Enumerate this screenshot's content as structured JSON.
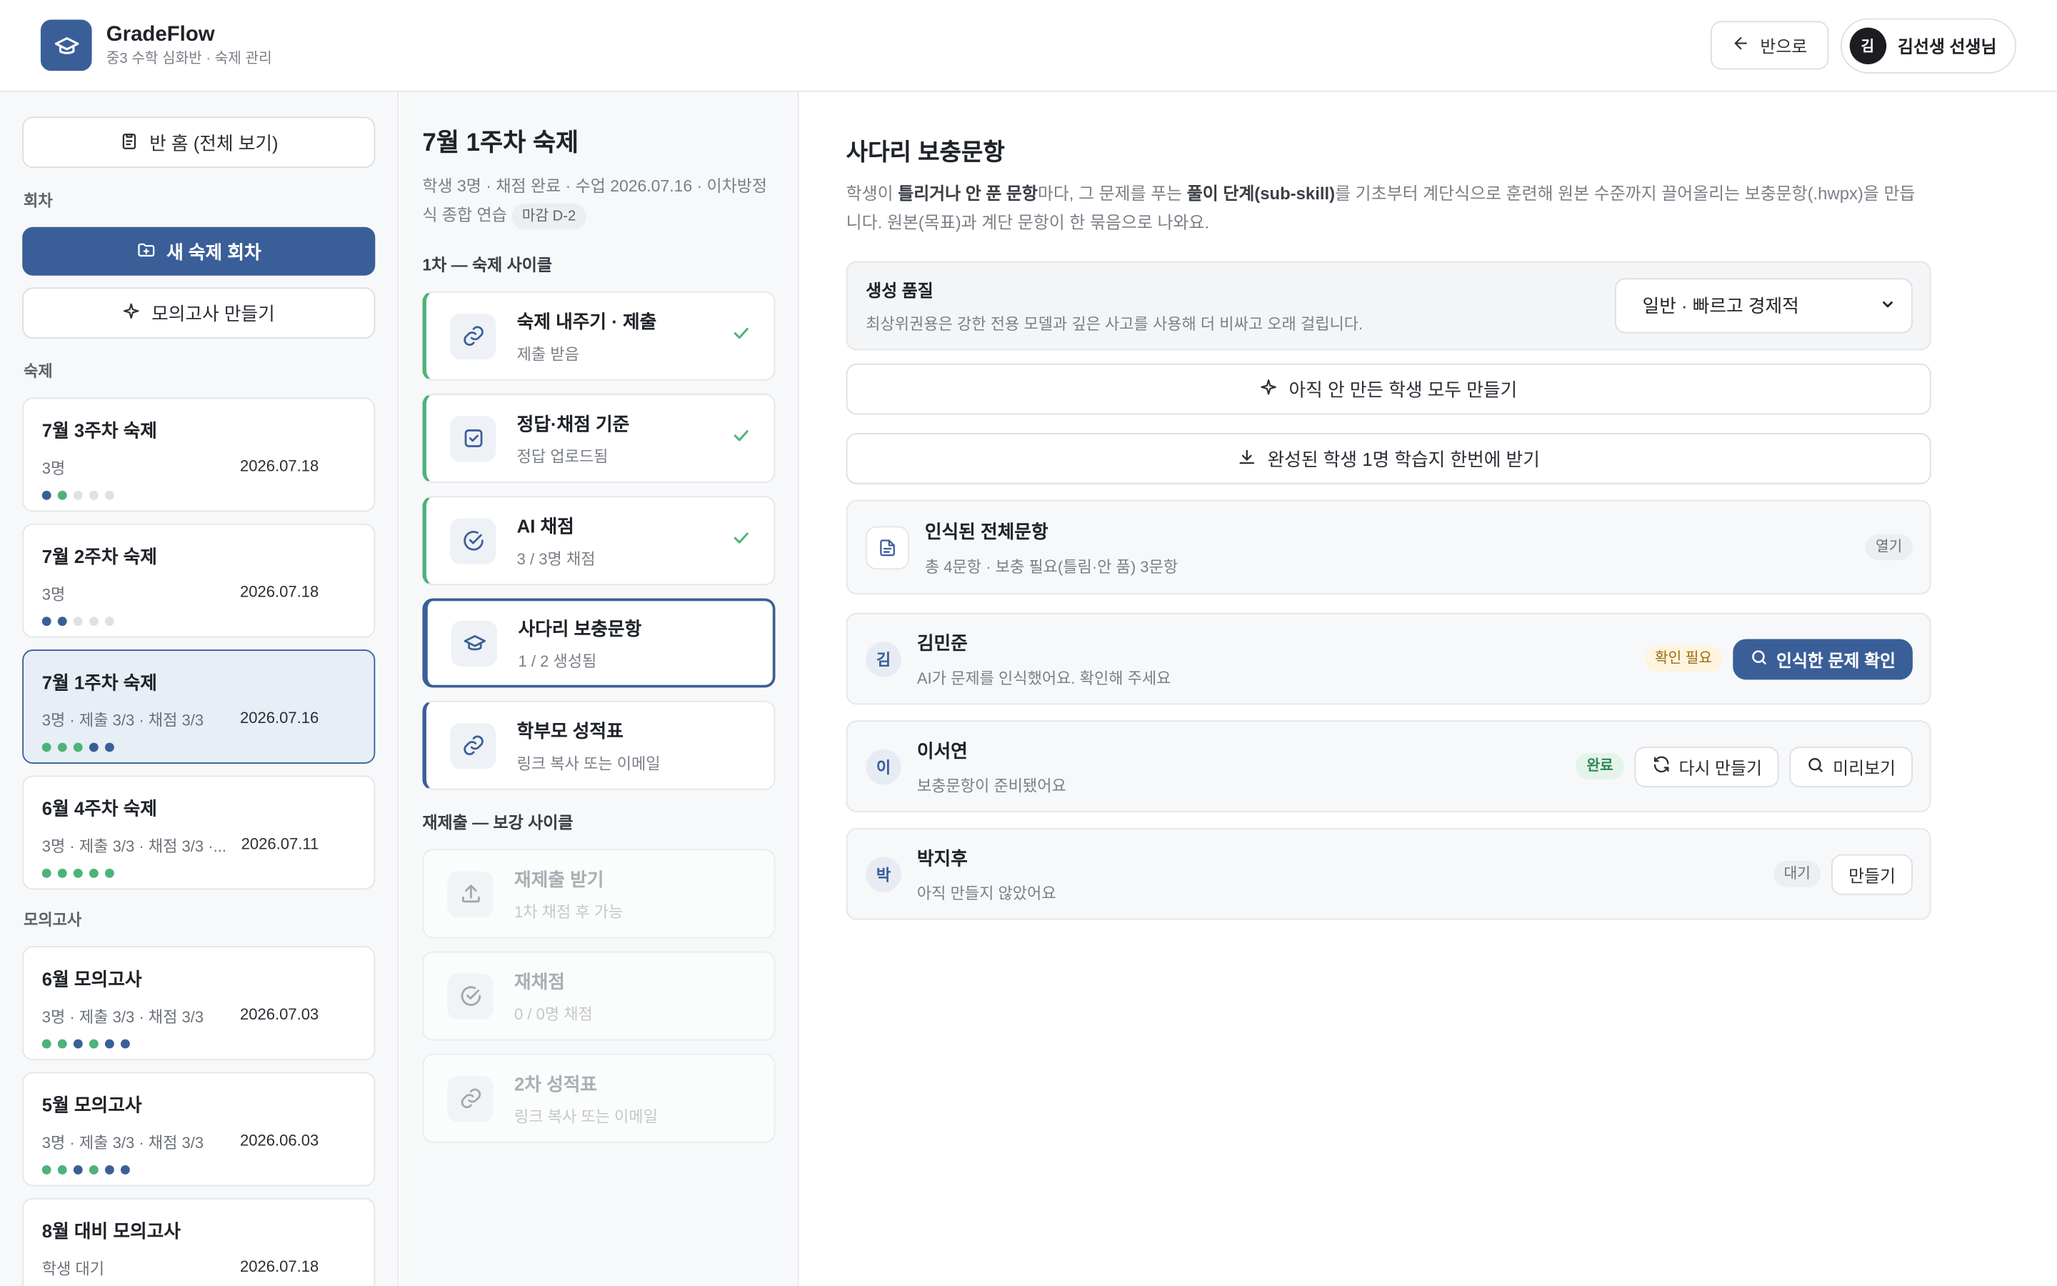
{
  "header": {
    "brand": "GradeFlow",
    "subtitle": "중3 수학 심화반 · 숙제 관리",
    "back_label": "반으로",
    "user_initial": "김",
    "user_name": "김선생 선생님"
  },
  "sidebar": {
    "home_label": "반 홈 (전체 보기)",
    "section_rounds": "회차",
    "new_round_label": "새 숙제 회차",
    "mock_exam_label": "모의고사 만들기",
    "section_homework": "숙제",
    "homework": [
      {
        "title": "7월 3주차 숙제",
        "meta": "3명",
        "date": "2026.07.18",
        "dots": [
          "blue",
          "green",
          "gray",
          "gray",
          "gray"
        ]
      },
      {
        "title": "7월 2주차 숙제",
        "meta": "3명",
        "date": "2026.07.18",
        "dots": [
          "blue",
          "blue",
          "gray",
          "gray",
          "gray"
        ]
      },
      {
        "title": "7월 1주차 숙제",
        "meta": "3명 · 제출 3/3 · 채점 3/3",
        "date": "2026.07.16",
        "dots": [
          "green",
          "green",
          "green",
          "blue",
          "blue"
        ],
        "active": true
      },
      {
        "title": "6월 4주차 숙제",
        "meta": "3명 · 제출 3/3 · 채점 3/3 ·...",
        "date": "2026.07.11",
        "dots": [
          "green",
          "green",
          "green",
          "green",
          "green"
        ]
      }
    ],
    "section_mock": "모의고사",
    "mock_exams": [
      {
        "title": "6월 모의고사",
        "meta": "3명 · 제출 3/3 · 채점 3/3",
        "date": "2026.07.03",
        "dots": [
          "green",
          "green",
          "blue",
          "green",
          "blue",
          "blue"
        ]
      },
      {
        "title": "5월 모의고사",
        "meta": "3명 · 제출 3/3 · 채점 3/3",
        "date": "2026.06.03",
        "dots": [
          "green",
          "green",
          "blue",
          "green",
          "blue",
          "blue"
        ]
      },
      {
        "title": "8월 대비 모의고사",
        "meta": "학생 대기",
        "date": "2026.07.18",
        "dots": []
      }
    ]
  },
  "pipeline": {
    "title": "7월 1주차 숙제",
    "meta": "학생 3명 · 채점 완료 · 수업 2026.07.16 · 이차방정식 종합 연습",
    "deadline": "마감 D-2",
    "section_first": "1차 — 숙제 사이클",
    "steps_first": [
      {
        "title": "숙제 내주기 · 제출",
        "sub": "제출 받음",
        "icon": "link-icon",
        "state": "done"
      },
      {
        "title": "정답·채점 기준",
        "sub": "정답 업로드됨",
        "icon": "checkbox-icon",
        "state": "done"
      },
      {
        "title": "AI 채점",
        "sub": "3 / 3명 채점",
        "icon": "check-circle-icon",
        "state": "done"
      },
      {
        "title": "사다리 보충문항",
        "sub": "1 / 2 생성됨",
        "icon": "graduation-cap-icon",
        "state": "current"
      },
      {
        "title": "학부모 성적표",
        "sub": "링크 복사 또는 이메일",
        "icon": "link-icon",
        "state": "link"
      }
    ],
    "section_second": "재제출 — 보강 사이클",
    "steps_second": [
      {
        "title": "재제출 받기",
        "sub": "1차 채점 후 가능",
        "icon": "upload-icon"
      },
      {
        "title": "재채점",
        "sub": "0 / 0명 채점",
        "icon": "check-circle-icon"
      },
      {
        "title": "2차 성적표",
        "sub": "링크 복사 또는 이메일",
        "icon": "link-icon"
      }
    ]
  },
  "main": {
    "title": "사다리 보충문항",
    "desc_1": "학생이 ",
    "desc_b1": "틀리거나 안 푼 문항",
    "desc_2": "마다, 그 문제를 푸는 ",
    "desc_b2": "풀이 단계(sub-skill)",
    "desc_3": "를 기초부터 계단식으로 훈련해 원본 수준까지 끌어올리는 보충문항(.hwpx)을 만듭니다. 원본(목표)과 계단 문항이 한 묶음으로 나와요.",
    "quality_title": "생성 품질",
    "quality_sub": "최상위권용은 강한 전용 모델과 깊은 사고를 사용해 더 비싸고 오래 걸립니다.",
    "quality_value": "일반 · 빠르고 경제적",
    "make_all_label": "아직 안 만든 학생 모두 만들기",
    "download_all_label": "완성된 학생 1명 학습지 한번에 받기",
    "recognized": {
      "title": "인식된 전체문항",
      "sub": "총 4문항 · 보충 필요(틀림·안 품) 3문항",
      "action": "열기"
    },
    "students": [
      {
        "initial": "김",
        "name": "김민준",
        "sub": "AI가 문제를 인식했어요. 확인해 주세요",
        "tag": "확인 필요",
        "tag_type": "warn",
        "primary_action": "인식한 문제 확인"
      },
      {
        "initial": "이",
        "name": "이서연",
        "sub": "보충문항이 준비됐어요",
        "tag": "완료",
        "tag_type": "ok",
        "action_a": "다시 만들기",
        "action_b": "미리보기"
      },
      {
        "initial": "박",
        "name": "박지후",
        "sub": "아직 만들지 않았어요",
        "tag": "대기",
        "tag_type": "gray",
        "action_a": "만들기"
      }
    ]
  },
  "colors": {
    "accent": "#3a5f98",
    "done": "#4eb27a",
    "warn_bg": "#fff4df",
    "ok_bg": "#e4f4ea"
  }
}
